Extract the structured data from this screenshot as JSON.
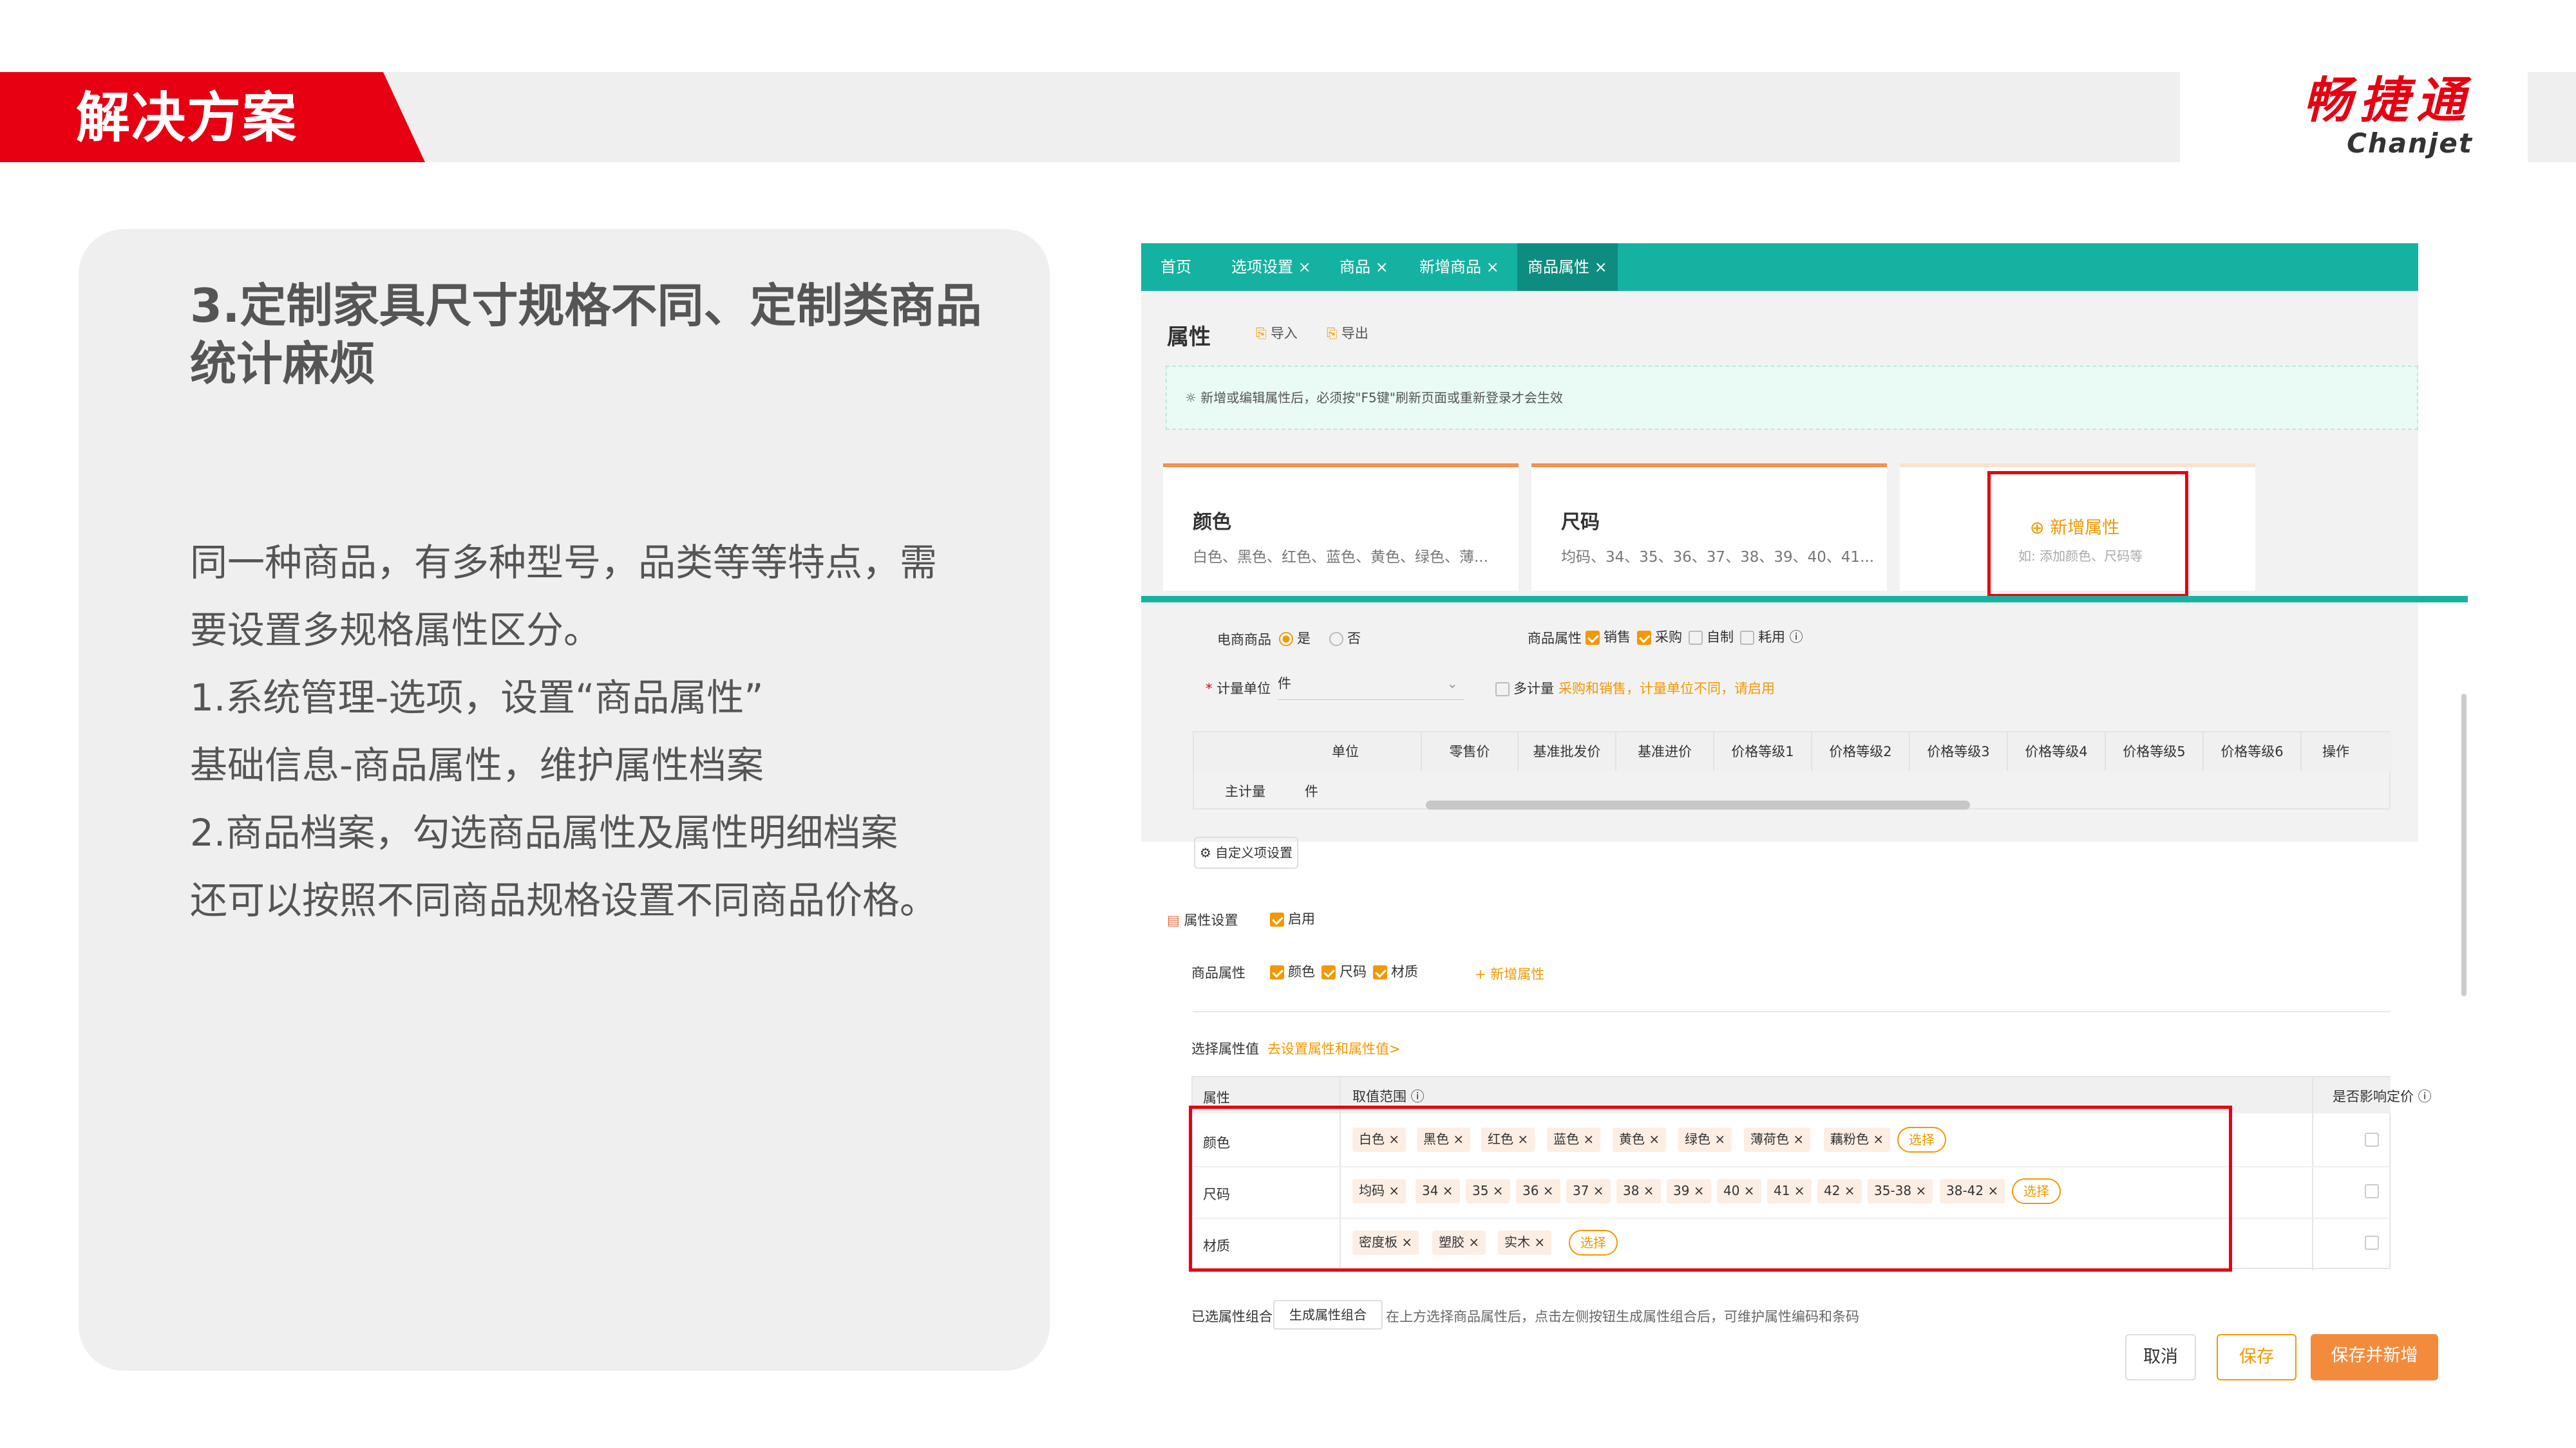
{
  "header": {
    "title": "解决方案",
    "logo_cn": "畅捷通",
    "logo_en": "Chanjet"
  },
  "card": {
    "title": "3.定制家具尺寸规格不同、定制类商品统计麻烦",
    "lines": [
      "同一种商品，有多种型号，品类等等特点，需",
      "要设置多规格属性区分。",
      "1.系统管理-选项，设置“商品属性”",
      "基础信息-商品属性，维护属性档案",
      "2.商品档案，勾选商品属性及属性明细档案",
      "还可以按照不同商品规格设置不同商品价格。"
    ]
  },
  "app": {
    "tabs": [
      "首页",
      "选项设置 ×",
      "商品 ×",
      "新增商品 ×",
      "商品属性 ×"
    ],
    "section_title": "属性",
    "import": "导入",
    "export": "导出",
    "notice": "新增或编辑属性后，必须按\"F5键\"刷新页面或重新登录才会生效",
    "color_card": {
      "title": "颜色",
      "values": "白色、黑色、红色、蓝色、黄色、绿色、薄..."
    },
    "size_card": {
      "title": "尺码",
      "values": "均码、34、35、36、37、38、39、40、41..."
    },
    "add_card": {
      "label": "新增属性",
      "hint": "如: 添加颜色、尺码等"
    },
    "form": {
      "ecom_label": "电商商品",
      "yes": "是",
      "no": "否",
      "prop_label": "商品属性",
      "sale": "销售",
      "purchase": "采购",
      "self_made": "自制",
      "consume": "耗用",
      "unit_label": "计量单位",
      "unit_value": "件",
      "multi_unit": "多计量",
      "multi_unit_hint": "采购和销售，计量单位不同，请启用"
    },
    "price_headers": [
      "单位",
      "零售价",
      "基准批发价",
      "基准进价",
      "价格等级1",
      "价格等级2",
      "价格等级3",
      "价格等级4",
      "价格等级5",
      "价格等级6",
      "操作"
    ],
    "price_row": {
      "label": "主计量",
      "unit": "件"
    },
    "custom_btn": "自定义项设置",
    "attr_settings": {
      "label": "属性设置",
      "enable": "启用"
    },
    "goods_attrs": {
      "label": "商品属性",
      "items": [
        "颜色",
        "尺码",
        "材质"
      ],
      "add": "+ 新增属性"
    },
    "choose": {
      "label": "选择属性值",
      "link": "去设置属性和属性值>"
    },
    "value_table": {
      "headers": [
        "属性",
        "取值范围",
        "是否影响定价"
      ],
      "rows": [
        {
          "name": "颜色",
          "tags": [
            "白色 ×",
            "黑色 ×",
            "红色 ×",
            "蓝色 ×",
            "黄色 ×",
            "绿色 ×",
            "薄荷色 ×",
            "藕粉色 ×"
          ]
        },
        {
          "name": "尺码",
          "tags": [
            "均码 ×",
            "34 ×",
            "35 ×",
            "36 ×",
            "37 ×",
            "38 ×",
            "39 ×",
            "40 ×",
            "41 ×",
            "42 ×",
            "35-38 ×",
            "38-42 ×"
          ]
        },
        {
          "name": "材质",
          "tags": [
            "密度板 ×",
            "塑胶 ×",
            "实木 ×"
          ]
        }
      ],
      "select_label": "选择"
    },
    "combo": {
      "label": "已选属性组合",
      "gen_btn": "生成属性组合",
      "hint": "在上方选择商品属性后，点击左侧按钮生成属性组合后，可维护属性编码和条码"
    },
    "buttons": {
      "cancel": "取消",
      "save": "保存",
      "save_new": "保存并新增"
    }
  },
  "colors": {
    "brand_red": "#e60012",
    "teal": "#15b2a1",
    "orange": "#f39800"
  }
}
